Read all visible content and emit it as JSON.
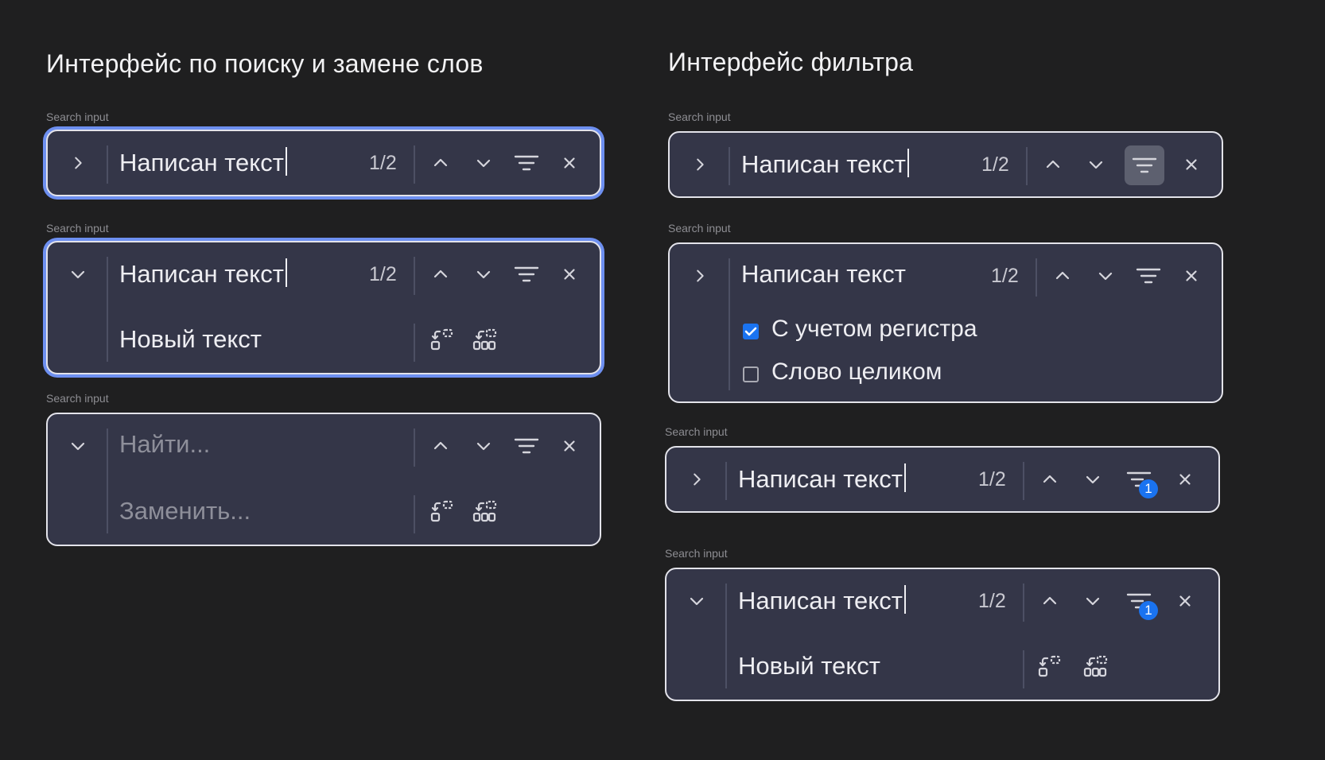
{
  "left_title": "Интерфейс по поиску и замене слов",
  "right_title": "Интерфейс фильтра",
  "caption": "Search input",
  "search_value": "Написан текст",
  "replace_value": "Новый текст",
  "search_placeholder": "Найти...",
  "replace_placeholder": "Заменить...",
  "counter": "1/2",
  "options": {
    "match_case": "С учетом регистра",
    "whole_word": "Слово целиком"
  },
  "filter_badge": "1",
  "colors": {
    "focus_ring": "#6d8ff0",
    "badge": "#1a73f0",
    "panel": "#343648"
  },
  "icons": [
    "chevron-right-icon",
    "chevron-down-icon",
    "arrow-up-icon",
    "arrow-down-icon",
    "filter-icon",
    "close-icon",
    "replace-icon",
    "replace-all-icon"
  ]
}
